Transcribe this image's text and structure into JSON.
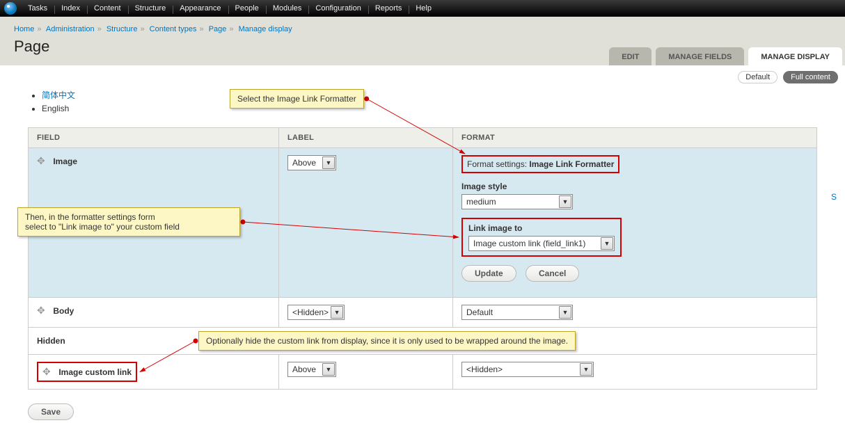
{
  "toolbar": [
    "Tasks",
    "Index",
    "Content",
    "Structure",
    "Appearance",
    "People",
    "Modules",
    "Configuration",
    "Reports",
    "Help"
  ],
  "breadcrumbs": [
    "Home",
    "Administration",
    "Structure",
    "Content types",
    "Page",
    "Manage display"
  ],
  "page_title": "Page",
  "tabs": {
    "edit": "Edit",
    "manage_fields": "Manage Fields",
    "manage_display": "Manage Display"
  },
  "subtabs": {
    "default": "Default",
    "full": "Full content"
  },
  "langs": {
    "zh": "简体中文",
    "en": "English"
  },
  "table": {
    "head": {
      "field": "FIELD",
      "label": "LABEL",
      "format": "FORMAT"
    },
    "row_image": {
      "name": "Image",
      "label": "Above"
    },
    "row_body": {
      "name": "Body",
      "label": "<Hidden>",
      "format": "Default"
    },
    "hidden_section": "Hidden",
    "row_custom": {
      "name": "Image custom link",
      "label": "Above",
      "format": "<Hidden>"
    }
  },
  "format_settings": {
    "prefix": "Format settings: ",
    "name": "Image Link Formatter",
    "image_style_label": "Image style",
    "image_style_value": "medium",
    "link_label": "Link image to",
    "link_value": "Image custom link (field_link1)",
    "update": "Update",
    "cancel": "Cancel"
  },
  "save": "Save",
  "s_link": "S",
  "callouts": {
    "c1": "Select the Image Link Formatter",
    "c2a": "Then, in the formatter settings form",
    "c2b": "select to \"Link image to\" your custom field",
    "c3": "Optionally hide the custom link from display, since it is only used to be wrapped around the image."
  }
}
